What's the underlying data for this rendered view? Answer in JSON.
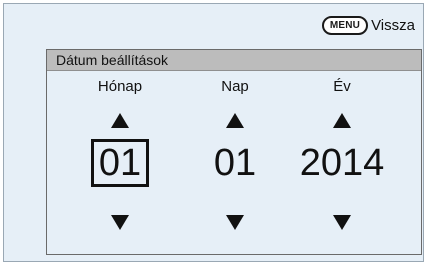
{
  "top_bar": {
    "menu_key": "MENU",
    "back_label": "Vissza"
  },
  "panel": {
    "title": "Dátum beállítások",
    "columns": [
      {
        "label": "Hónap",
        "value": "01",
        "selected": true
      },
      {
        "label": "Nap",
        "value": "01",
        "selected": false
      },
      {
        "label": "Év",
        "value": "2014",
        "selected": false
      }
    ]
  },
  "colors": {
    "background": "#e6eff7",
    "header": "#bcbcbc",
    "text": "#111111"
  }
}
